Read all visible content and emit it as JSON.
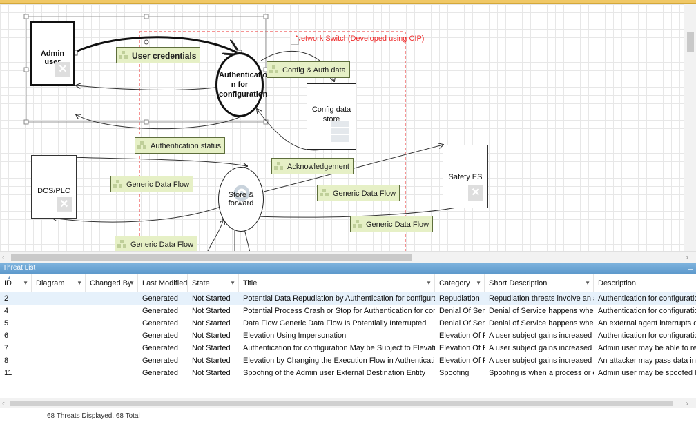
{
  "diagram": {
    "boundary_label": "Network Switch(Developed using CIP)",
    "entities": {
      "admin_user": "Admin user",
      "dcs_plc": "DCS/PLC",
      "safety_es": "Safety ES"
    },
    "processes": {
      "authentication": "Authenticatio n for configuration",
      "store_forward": "Store & forward"
    },
    "store": "Config data store",
    "flows": {
      "user_credentials": "User credentials",
      "config_auth_data": "Config & Auth data",
      "authentication_status": "Authentication status",
      "acknowledgement": "Acknowledgement",
      "generic_flow_1": "Generic Data Flow",
      "generic_flow_2": "Generic Data Flow",
      "generic_flow_3": "Generic Data Flow",
      "generic_flow_4": "Generic Data Flow"
    }
  },
  "threat_list": {
    "title": "Threat List",
    "columns": [
      "ID",
      "Diagram",
      "Changed By",
      "Last Modified",
      "State",
      "Title",
      "Category",
      "Short Description",
      "Description"
    ],
    "rows": [
      {
        "id": "2",
        "diagram": "",
        "changed_by": "",
        "last_modified": "Generated",
        "state": "Not Started",
        "title": "Potential Data Repudiation by Authentication for configuration",
        "category": "Repudiation",
        "short": "Repudiation threats involve an adver...",
        "desc": "Authentication for configuration cl"
      },
      {
        "id": "4",
        "diagram": "",
        "changed_by": "",
        "last_modified": "Generated",
        "state": "Not Started",
        "title": "Potential Process Crash or Stop for Authentication for configuration",
        "category": "Denial Of Servi...",
        "short": "Denial of Service happens when the...",
        "desc": "Authentication for configuration cr"
      },
      {
        "id": "5",
        "diagram": "",
        "changed_by": "",
        "last_modified": "Generated",
        "state": "Not Started",
        "title": "Data Flow Generic Data Flow Is Potentially Interrupted",
        "category": "Denial Of Servi...",
        "short": "Denial of Service happens when the...",
        "desc": "An external agent interrupts data fl"
      },
      {
        "id": "6",
        "diagram": "",
        "changed_by": "",
        "last_modified": "Generated",
        "state": "Not Started",
        "title": "Elevation Using Impersonation",
        "category": "Elevation Of Pr...",
        "short": "A user subject gains increased capab...",
        "desc": "Authentication for configuration m"
      },
      {
        "id": "7",
        "diagram": "",
        "changed_by": "",
        "last_modified": "Generated",
        "state": "Not Started",
        "title": "Authentication for configuration May be Subject to Elevation of Priv...",
        "category": "Elevation Of Pr...",
        "short": "A user subject gains increased capab...",
        "desc": "Admin user may be able to remote"
      },
      {
        "id": "8",
        "diagram": "",
        "changed_by": "",
        "last_modified": "Generated",
        "state": "Not Started",
        "title": "Elevation by Changing the Execution Flow in Authentication for con...",
        "category": "Elevation Of Pr...",
        "short": "A user subject gains increased capab...",
        "desc": "An attacker may pass data into Aut"
      },
      {
        "id": "11",
        "diagram": "",
        "changed_by": "",
        "last_modified": "Generated",
        "state": "Not Started",
        "title": "Spoofing of the Admin user External Destination Entity",
        "category": "Spoofing",
        "short": "Spoofing is when a process or entity...",
        "desc": "Admin user may be spoofed by an"
      }
    ],
    "status": "68 Threats Displayed, 68 Total"
  },
  "colors": {
    "accent_bar": "#f0c866",
    "panel_title": "#6aa5d6",
    "boundary": "#ee2a2a",
    "flow_label_bg": "#e6f0c6",
    "selected_row": "#e6f1fb"
  },
  "icons": [
    "x-icon",
    "dataflow-icon",
    "gear-icon",
    "database-icon",
    "sort-arrow-icon",
    "dropdown-icon",
    "pin-icon",
    "scroll-left-icon",
    "scroll-right-icon"
  ]
}
